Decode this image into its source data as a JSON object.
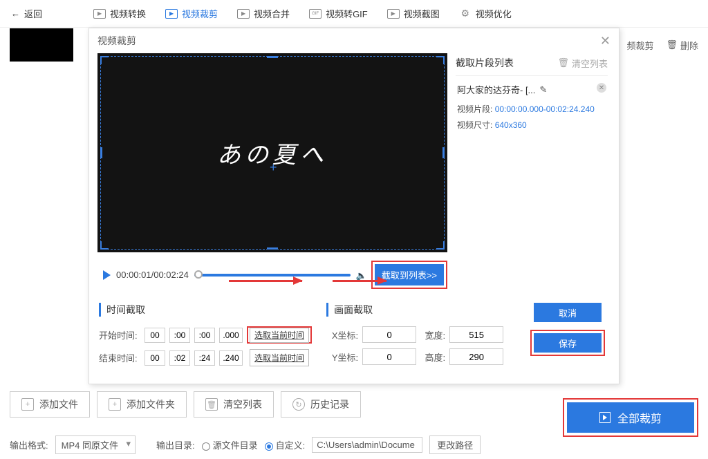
{
  "topbar": {
    "back": "返回",
    "tools": [
      {
        "label": "视频转换",
        "hint": "▶"
      },
      {
        "label": "视频裁剪",
        "hint": "▶",
        "active": true
      },
      {
        "label": "视频合并",
        "hint": "▶"
      },
      {
        "label": "视频转GIF",
        "hint": "GIF"
      },
      {
        "label": "视频截图",
        "hint": "▶"
      },
      {
        "label": "视频优化",
        "hint": "≡"
      }
    ]
  },
  "row2": {
    "right_a": "频裁剪",
    "right_b": "删除"
  },
  "modal": {
    "title": "视频裁剪",
    "preview_text": "あの夏へ",
    "play_time": "00:00:01/00:02:24",
    "capture_btn": "截取到列表>>",
    "right": {
      "title": "截取片段列表",
      "clear": "清空列表",
      "clip_name": "阿大家的达芬奇- [...",
      "seg_label": "视频片段:",
      "seg_val": "00:00:00.000-00:02:24.240",
      "size_label": "视频尺寸:",
      "size_val": "640x360"
    },
    "time_sect": {
      "title": "时间截取",
      "start_label": "开始时间:",
      "start": {
        "h": "00",
        "m": ":00",
        "s": ":00",
        "ms": ".000"
      },
      "end_label": "结束时间:",
      "end": {
        "h": "00",
        "m": ":02",
        "s": ":24",
        "ms": ".240"
      },
      "pick": "选取当前时间"
    },
    "frame_sect": {
      "title": "画面截取",
      "x_label": "X坐标:",
      "x_val": "0",
      "y_label": "Y坐标:",
      "y_val": "0",
      "w_label": "宽度:",
      "w_val": "515",
      "h_label": "高度:",
      "h_val": "290"
    },
    "buttons": {
      "cancel": "取消",
      "save": "保存"
    }
  },
  "bottom_toolbar": {
    "add_file": "添加文件",
    "add_folder": "添加文件夹",
    "clear_list": "清空列表",
    "history": "历史记录"
  },
  "crop_all": "全部裁剪",
  "outrow": {
    "fmt_label": "输出格式:",
    "fmt_val": "MP4 同原文件",
    "dir_label": "输出目录:",
    "opt_src": "源文件目录",
    "opt_custom": "自定义:",
    "path": "C:\\Users\\admin\\Docume",
    "change": "更改路径"
  }
}
